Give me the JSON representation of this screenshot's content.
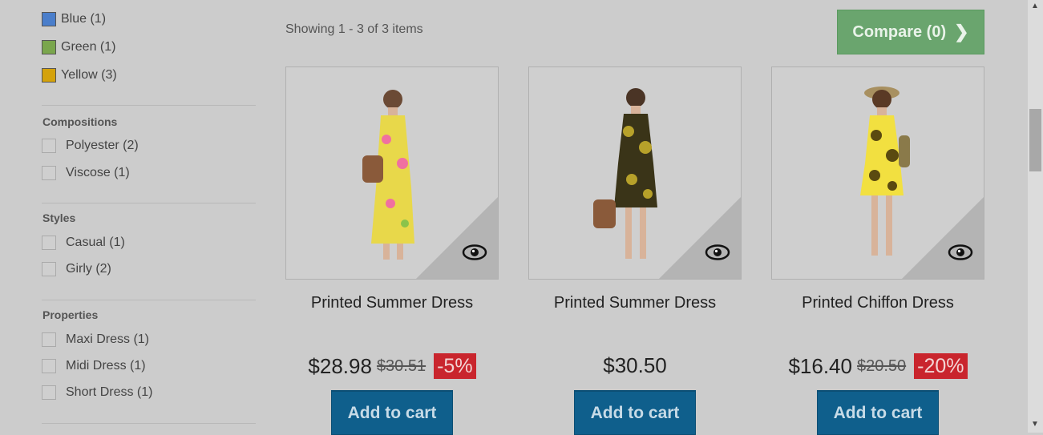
{
  "filters": {
    "colors": [
      {
        "label": "Blue (1)",
        "color": "#4a7ecb"
      },
      {
        "label": "Green (1)",
        "color": "#7aa64d"
      },
      {
        "label": "Yellow (3)",
        "color": "#d4a20b"
      }
    ],
    "compositions": {
      "title": "Compositions",
      "items": [
        "Polyester (2)",
        "Viscose (1)"
      ]
    },
    "styles": {
      "title": "Styles",
      "items": [
        "Casual (1)",
        "Girly (2)"
      ]
    },
    "properties": {
      "title": "Properties",
      "items": [
        "Maxi Dress (1)",
        "Midi Dress (1)",
        "Short Dress (1)"
      ]
    }
  },
  "listing": {
    "showing": "Showing 1 - 3 of 3 items",
    "compare_label": "Compare (0)"
  },
  "products": [
    {
      "name": "Printed Summer Dress",
      "price": "$28.98",
      "old_price": "$30.51",
      "discount": "-5%",
      "cta": "Add to cart",
      "dress_colors": [
        "#e8d84a",
        "#f070a0"
      ]
    },
    {
      "name": "Printed Summer Dress",
      "price": "$30.50",
      "old_price": "",
      "discount": "",
      "cta": "Add to cart",
      "dress_colors": [
        "#3a3418",
        "#b7a12a"
      ]
    },
    {
      "name": "Printed Chiffon Dress",
      "price": "$16.40",
      "old_price": "$20.50",
      "discount": "-20%",
      "cta": "Add to cart",
      "dress_colors": [
        "#f2e040",
        "#5a4a10"
      ]
    }
  ]
}
